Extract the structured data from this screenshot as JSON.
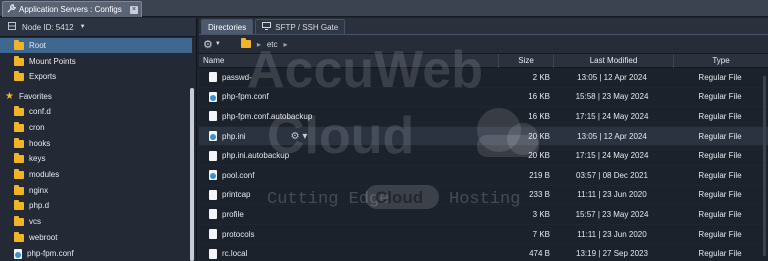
{
  "window": {
    "title": "Application Servers : Configs",
    "close": "×"
  },
  "left": {
    "node_label": "Node ID: 5412",
    "tree": [
      {
        "label": "Root",
        "icon": "folder-icon",
        "selected": true
      },
      {
        "label": "Mount Points",
        "icon": "folder-icon"
      },
      {
        "label": "Exports",
        "icon": "folder-link-icon"
      }
    ],
    "favorites_label": "Favorites",
    "favorites": [
      {
        "label": "conf.d",
        "icon": "folder-icon"
      },
      {
        "label": "cron",
        "icon": "folder-icon"
      },
      {
        "label": "hooks",
        "icon": "folder-icon"
      },
      {
        "label": "keys",
        "icon": "folder-icon"
      },
      {
        "label": "modules",
        "icon": "folder-icon"
      },
      {
        "label": "nginx",
        "icon": "folder-icon"
      },
      {
        "label": "php.d",
        "icon": "folder-icon"
      },
      {
        "label": "vcs",
        "icon": "folder-icon"
      },
      {
        "label": "webroot",
        "icon": "folder-icon"
      },
      {
        "label": "php-fpm.conf",
        "icon": "config-file-icon"
      }
    ]
  },
  "right": {
    "tabs": [
      {
        "label": "Directories",
        "active": true
      },
      {
        "label": "SFTP / SSH Gate",
        "active": false
      }
    ],
    "breadcrumb": [
      "etc"
    ],
    "columns": {
      "name": "Name",
      "size": "Size",
      "modified": "Last Modified",
      "type": "Type"
    },
    "files": [
      {
        "name": "passwd-",
        "size": "2 KB",
        "modified": "13:05 | 12 Apr 2024",
        "type": "Regular File",
        "icon": "file-icon"
      },
      {
        "name": "php-fpm.conf",
        "size": "16 KB",
        "modified": "15:58 | 23 May 2024",
        "type": "Regular File",
        "icon": "config-file-icon"
      },
      {
        "name": "php-fpm.conf.autobackup",
        "size": "16 KB",
        "modified": "17:15 | 24 May 2024",
        "type": "Regular File",
        "icon": "file-icon"
      },
      {
        "name": "php.ini",
        "size": "20 KB",
        "modified": "13:05 | 12 Apr 2024",
        "type": "Regular File",
        "icon": "config-file-icon",
        "highlighted": true
      },
      {
        "name": "php.ini.autobackup",
        "size": "20 KB",
        "modified": "17:15 | 24 May 2024",
        "type": "Regular File",
        "icon": "file-icon"
      },
      {
        "name": "pool.conf",
        "size": "219 B",
        "modified": "03:57 | 08 Dec 2021",
        "type": "Regular File",
        "icon": "config-file-icon"
      },
      {
        "name": "printcap",
        "size": "233 B",
        "modified": "11:11 | 23 Jun 2020",
        "type": "Regular File",
        "icon": "file-icon"
      },
      {
        "name": "profile",
        "size": "3 KB",
        "modified": "15:57 | 23 May 2024",
        "type": "Regular File",
        "icon": "file-icon"
      },
      {
        "name": "protocols",
        "size": "7 KB",
        "modified": "11:11 | 23 Jun 2020",
        "type": "Regular File",
        "icon": "file-icon"
      },
      {
        "name": "rc.local",
        "size": "474 B",
        "modified": "13:19 | 27 Sep 2023",
        "type": "Regular File",
        "icon": "file-icon"
      }
    ]
  },
  "watermark": {
    "line1": "AccuWeb",
    "line2": "Cloud",
    "tagline_1": "Cutting Edge",
    "tagline_2": "Cloud",
    "tagline_3": "Hosting"
  },
  "colors": {
    "selection": "#3f6891",
    "folder": "#f0b429",
    "background": "#1c222c"
  }
}
